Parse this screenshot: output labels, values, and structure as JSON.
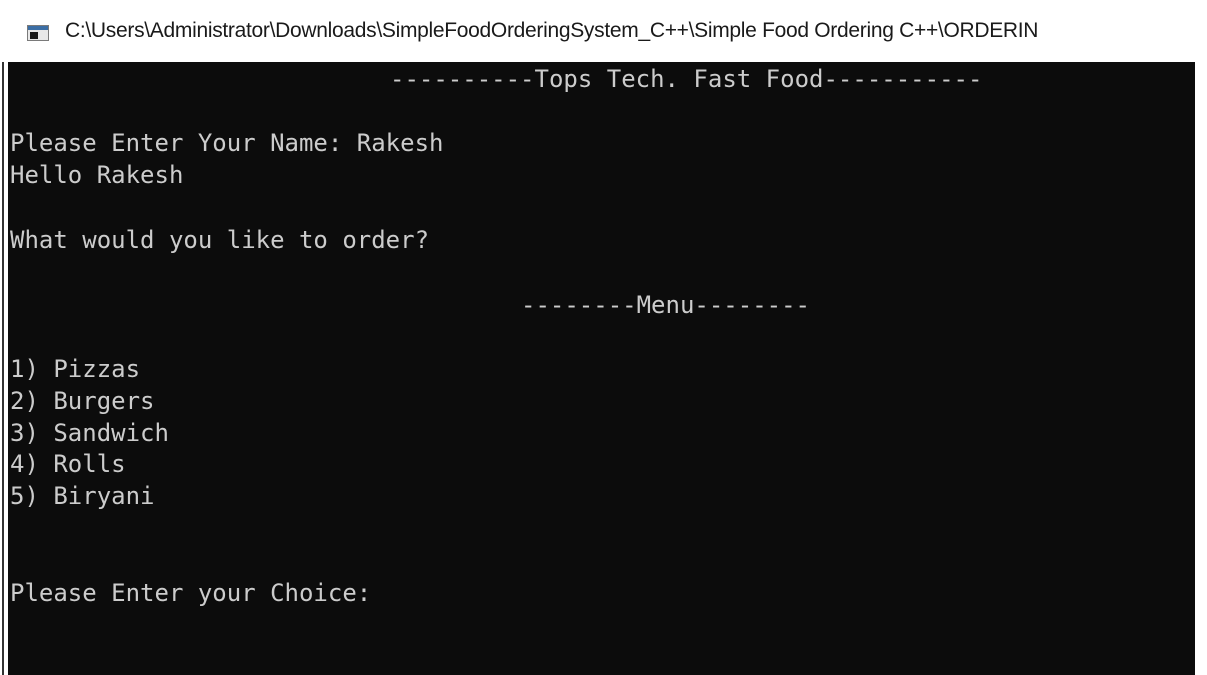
{
  "window": {
    "title": "C:\\Users\\Administrator\\Downloads\\SimpleFoodOrderingSystem_C++\\Simple Food Ordering C++\\ORDERIN"
  },
  "console": {
    "header": "----------Tops Tech. Fast Food-----------",
    "name_prompt": "Please Enter Your Name: Rakesh",
    "greeting": "Hello Rakesh",
    "question": "What would you like to order?",
    "menu_title": "--------Menu--------",
    "menu_items": [
      "1) Pizzas",
      "2) Burgers",
      "3) Sandwich",
      "4) Rolls",
      "5) Biryani"
    ],
    "choice_prompt": "Please Enter your Choice:"
  },
  "colors": {
    "console_background": "#0c0c0c",
    "console_text": "#cccccc"
  },
  "icons": {
    "app_icon": "console-window-icon"
  }
}
